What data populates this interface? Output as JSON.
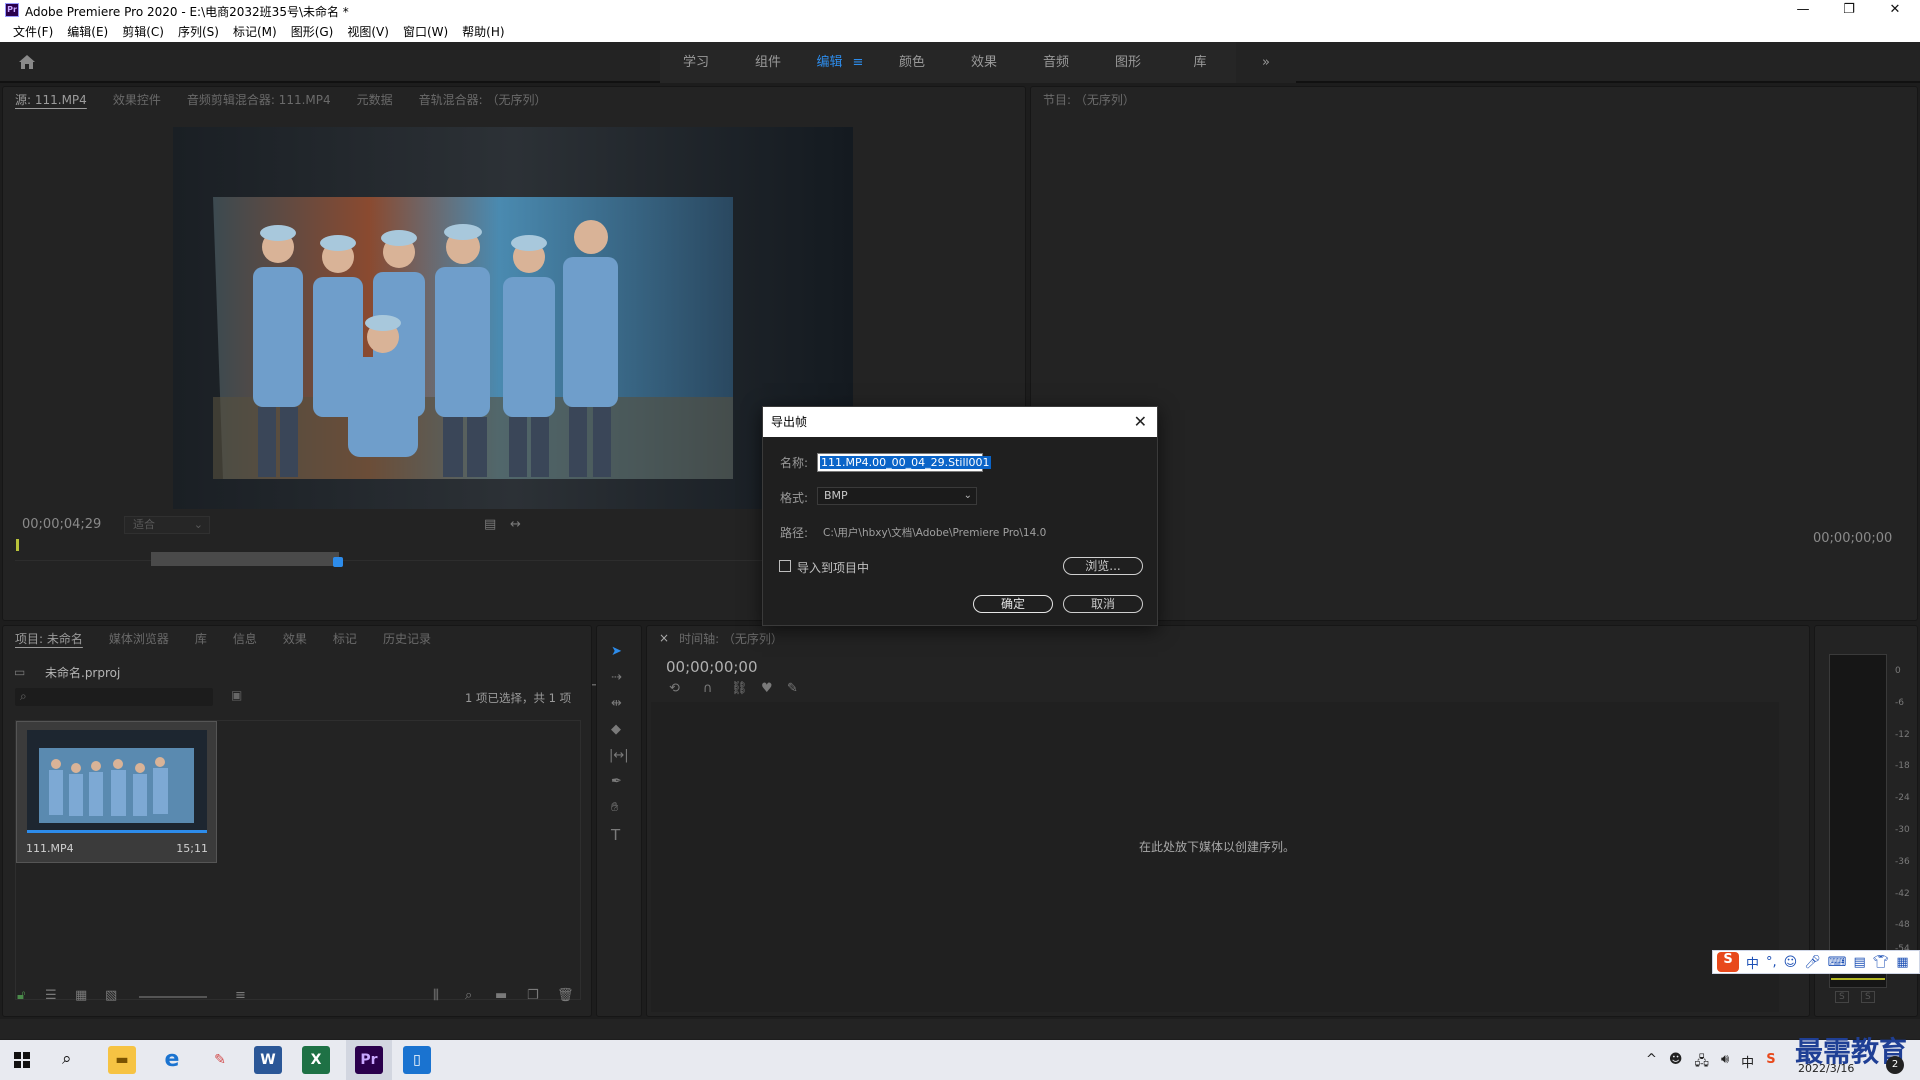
{
  "window": {
    "title": "Adobe Premiere Pro 2020 - E:\\电商2032班35号\\未命名 *",
    "app_icon": "Pr",
    "controls": {
      "minimize": "—",
      "restore": "❐",
      "close": "✕"
    }
  },
  "menu": [
    "文件(F)",
    "编辑(E)",
    "剪辑(C)",
    "序列(S)",
    "标记(M)",
    "图形(G)",
    "视图(V)",
    "窗口(W)",
    "帮助(H)"
  ],
  "workspaces": {
    "tabs": [
      "学习",
      "组件",
      "编辑",
      "颜色",
      "效果",
      "音频",
      "图形",
      "库"
    ],
    "active": "编辑",
    "overflow": "»"
  },
  "source_panel": {
    "tabs": [
      "源: 111.MP4",
      "效果控件",
      "音频剪辑混合器: 111.MP4",
      "元数据",
      "音轨混合器: （无序列）"
    ],
    "active_tab": "源: 111.MP4",
    "timecode": "00;00;04;29",
    "fit_select": "适合"
  },
  "program_panel": {
    "title": "节目: （无序列）",
    "timecode": "00;00;00;00"
  },
  "project_panel": {
    "tabs": [
      "项目: 未命名",
      "媒体浏览器",
      "库",
      "信息",
      "效果",
      "标记",
      "历史记录"
    ],
    "project_file": "未命名.prproj",
    "selection_status": "1 项已选择，共 1 项",
    "clip": {
      "name": "111.MP4",
      "duration": "15;11"
    }
  },
  "timeline_panel": {
    "title": "时间轴: （无序列）",
    "timecode": "00;00;00;00",
    "empty_hint": "在此处放下媒体以创建序列。"
  },
  "audio_meter": {
    "scale": [
      "0",
      "-6",
      "-12",
      "-18",
      "-24",
      "-30",
      "-36",
      "-42",
      "-48",
      "-54",
      "dB"
    ],
    "solo": [
      "S",
      "S"
    ]
  },
  "export_dialog": {
    "title": "导出帧",
    "name_label": "名称:",
    "name_value": "111.MP4.00_00_04_29.Still001",
    "format_label": "格式:",
    "format_value": "BMP",
    "path_label": "路径:",
    "path_value": "C:\\用户\\hbxy\\文档\\Adobe\\Premiere Pro\\14.0",
    "import_label": "导入到项目中",
    "import_checked": false,
    "browse": "浏览...",
    "ok": "确定",
    "cancel": "取消"
  },
  "taskbar": {
    "date": "2022/3/16",
    "notification_count": "2",
    "watermark": "最需教育",
    "ime": "中"
  }
}
